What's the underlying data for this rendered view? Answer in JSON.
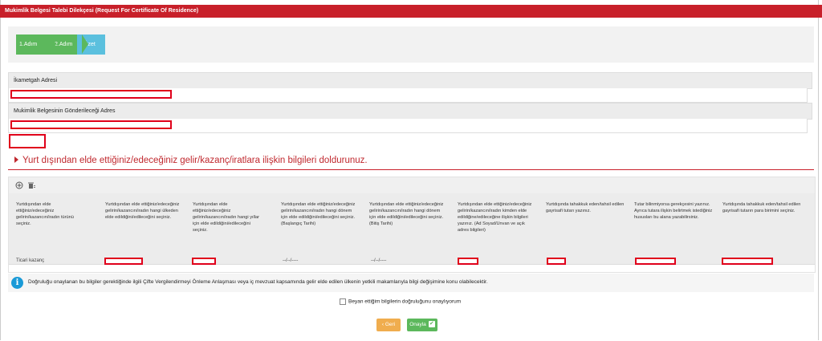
{
  "window": {
    "title": "Mukimlik Belgesi Talebi Dilekçesi (Request For Certificate Of Residence)"
  },
  "steps": [
    {
      "label": "1.Adım"
    },
    {
      "label": "2.Adım"
    },
    {
      "label": "Özet"
    }
  ],
  "address_section": {
    "title": "İkametgah Adresi"
  },
  "send_address_section": {
    "title": "Mukimlik Belgesinin Gönderileceği Adres"
  },
  "income_section": {
    "title": "Yurt dışından elde ettiğiniz/edeceğiniz gelir/kazanç/iratlara ilişkin bilgileri doldurunuz."
  },
  "table": {
    "columns": [
      "Yurtdışından elde ettiğiniz/edeceğiniz gelirin/kazancın/iradın türünü seçiniz.",
      "Yurtdışından elde ettiğiniz/edeceğiniz gelirin/kazancın/iradın hangi ülkeden elde edildiğini/edileceğini seçiniz.",
      "Yurtdışından elde ettiğiniz/edeceğiniz gelirin/kazancın/iradın hangi yıllar için elde edildiğini/edileceğini seçiniz.",
      "Yurtdışından elde ettiğiniz/edeceğiniz gelirin/kazancın/iradın hangi dönem için elde edildiğini/edileceğini seçiniz. (Başlangıç Tarihi)",
      "Yurtdışından elde ettiğiniz/edeceğiniz gelirin/kazancın/iradın hangi dönem için elde edildiğini/edileceğini seçiniz.(Bitiş Tarihi)",
      "Yurtdışından elde ettiğiniz/edeceğiniz gelirin/kazancın/iradın kimden elde edildiğine/edileceğine ilişkin bilgileri yazınız. (Ad Soyad/Unvan ve açık adres bilgileri)",
      "Yurtdışında tahakkuk eden/tahsil edilen gayrisafi tutarı yazınız.",
      "Tutar bilinmiyorsa gerekçesini yazınız. Ayrıca tutara ilişkin belirtmek istediğiniz hususları bu alana yazabilirsiniz.",
      "Yurtdışında tahakkuk eden/tahsil edilen gayrisafi tutarın para birimini seçiniz."
    ],
    "row": {
      "income_type": "Ticari kazanç",
      "start_date": "--/--/----",
      "end_date": "--/--/----"
    }
  },
  "info_text": "Doğruluğu onaylanan bu bilgiler gerektiğinde ilgili Çifte Vergilendirmeyi Önleme Anlaşması veya iç mevzuat kapsamında gelir elde edilen ülkenin yetkili makamlarıyla bilgi değişimine konu olabilecektir.",
  "confirm_checkbox": {
    "label": "Beyan ettiğim bilgilerin doğruluğunu onaylıyorum",
    "checked": false
  },
  "buttons": {
    "back": "Geri",
    "approve": "Onayla"
  },
  "colors": {
    "brand": "#c8202a",
    "step_done": "#5cb85c",
    "step_current": "#5bc0de",
    "redaction": "#e0001b"
  }
}
